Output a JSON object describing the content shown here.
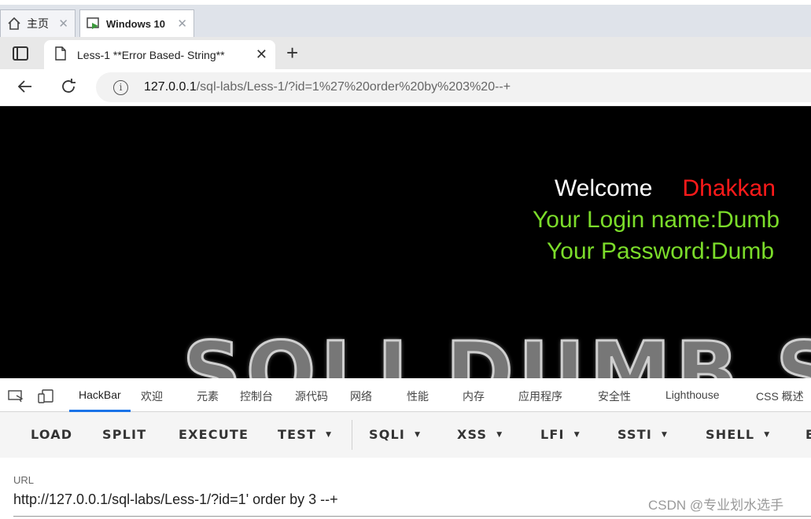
{
  "host_tabs": [
    {
      "label": "主页"
    },
    {
      "label": "Windows 10"
    }
  ],
  "browser": {
    "tab_title": "Less-1 **Error Based- String**",
    "url_host": "127.0.0.1",
    "url_path": "/sql-labs/Less-1/?id=1%27%20order%20by%203%20--+"
  },
  "page": {
    "welcome_label": "Welcome",
    "welcome_name": "Dhakkan",
    "login_line": "Your Login name:Dumb",
    "password_line": "Your Password:Dumb",
    "banner_text": "SQLI DUMB SERIES",
    "colors": {
      "background": "#000000",
      "welcome": "#ffffff",
      "name": "#ff1a1a",
      "info": "#7bdc2a"
    }
  },
  "devtools": {
    "tabs": [
      "HackBar",
      "欢迎",
      "元素",
      "控制台",
      "源代码",
      "网络",
      "性能",
      "内存",
      "应用程序",
      "安全性",
      "Lighthouse",
      "CSS 概述"
    ],
    "active_tab": "HackBar"
  },
  "hackbar": {
    "buttons": [
      {
        "label": "LOAD"
      },
      {
        "label": "SPLIT"
      },
      {
        "label": "EXECUTE"
      },
      {
        "label": "TEST"
      },
      {
        "label": "SQLI"
      },
      {
        "label": "XSS"
      },
      {
        "label": "LFI"
      },
      {
        "label": "SSTI"
      },
      {
        "label": "SHELL"
      },
      {
        "label": "E"
      }
    ],
    "url_label": "URL",
    "url_value": "http://127.0.0.1/sql-labs/Less-1/?id=1' order by 3 --+"
  },
  "watermark": "CSDN @专业划水选手",
  "icons": [
    "home-icon",
    "vm-icon",
    "tab-manager-icon",
    "page-icon",
    "back-icon",
    "refresh-icon",
    "info-icon",
    "inspect-icon",
    "device-icon"
  ]
}
